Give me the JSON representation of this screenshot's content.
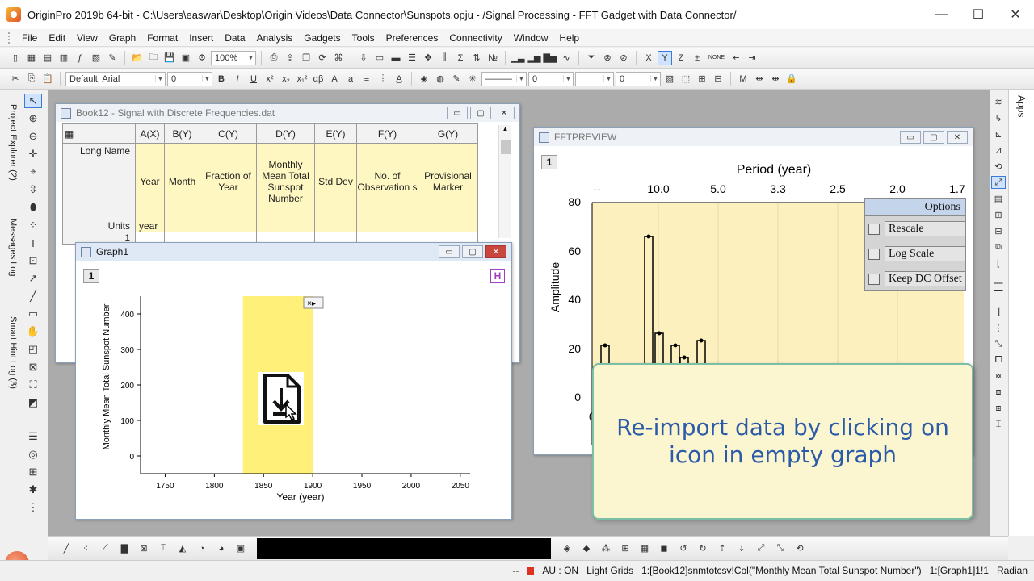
{
  "window": {
    "title": "OriginPro 2019b 64-bit - C:\\Users\\easwar\\Desktop\\Origin Videos\\Data Connector\\Sunspots.opju - /Signal Processing - FFT Gadget with Data Connector/",
    "minimize": "—",
    "maximize": "☐",
    "close": "✕"
  },
  "menu": [
    "File",
    "Edit",
    "View",
    "Graph",
    "Format",
    "Insert",
    "Data",
    "Analysis",
    "Gadgets",
    "Tools",
    "Preferences",
    "Connectivity",
    "Window",
    "Help"
  ],
  "toolbar": {
    "zoom": "100%",
    "font": "Default: Arial",
    "font_size": "0",
    "bold": "B",
    "italic": "I",
    "underline": "U",
    "greek": "αβ",
    "text_a": "A",
    "line_width": "0",
    "fill_value": "0",
    "none_label": "NONE"
  },
  "left_tabs": [
    "Project Explorer (2)",
    "Messages Log",
    "Smart Hint Log (3)"
  ],
  "apps_label": "Apps",
  "book": {
    "title": "Book12 - Signal with Discrete Frequencies.dat",
    "columns": [
      "A(X)",
      "B(Y)",
      "C(Y)",
      "D(Y)",
      "E(Y)",
      "F(Y)",
      "G(Y)"
    ],
    "long_name_label": "Long Name",
    "long_names": [
      "Year",
      "Month",
      "Fraction of Year",
      "Monthly Mean Total Sunspot Number",
      "Std Dev",
      "No. of Observation s",
      "Provisional Marker"
    ],
    "units_label": "Units",
    "units": [
      "year",
      "",
      "",
      "",
      "",
      "",
      ""
    ],
    "row1": "1"
  },
  "graph1": {
    "title": "Graph1",
    "layer": "1",
    "h_badge": "H",
    "ylabel": "Monthly Mean Total Sunspot Number",
    "xlabel": "Year (year)",
    "yticks": [
      "400",
      "300",
      "200",
      "100",
      "0"
    ],
    "xticks": [
      "1750",
      "1800",
      "1850",
      "1900",
      "1950",
      "2000",
      "2050"
    ],
    "import_icon": "reimport-file-icon"
  },
  "fft": {
    "title": "FFTPREVIEW",
    "layer": "1",
    "top_axis_label": "Period (year)",
    "top_ticks": [
      "--",
      "10.0",
      "5.0",
      "3.3",
      "2.5",
      "2.0",
      "1.7"
    ],
    "ylabel": "Amplitude",
    "yticks": [
      "80",
      "60",
      "40",
      "20",
      "0"
    ],
    "bottom_partial": "0",
    "options": {
      "title": "Options",
      "items": [
        "Rescale",
        "Log Scale",
        "Keep DC Offset"
      ]
    }
  },
  "chart_data": [
    {
      "type": "bar",
      "title": "",
      "xlabel": "Year (year)",
      "ylabel": "Monthly Mean Total Sunspot Number",
      "xlim": [
        1725,
        2060
      ],
      "ylim": [
        -50,
        450
      ],
      "highlight_range": [
        1829,
        1900
      ],
      "highlight_color": "#fff07a",
      "values": []
    },
    {
      "type": "bar",
      "title": "",
      "xlabel": "Period (year)",
      "ylabel": "Amplitude",
      "ylim": [
        0,
        80
      ],
      "series": [
        {
          "values": [
            21,
            66,
            26,
            21,
            16,
            23
          ]
        }
      ]
    }
  ],
  "callout": {
    "line1": "Re-import data by clicking on",
    "line2": "icon in empty graph"
  },
  "status": {
    "dashes": "--",
    "au": "AU : ON",
    "light_grids": "Light Grids",
    "book_ref": "1:[Book12]snmtotcsv!Col(\"Monthly Mean Total Sunspot Number\")",
    "graph_ref": "1:[Graph1]1!1",
    "angle": "Radian"
  }
}
